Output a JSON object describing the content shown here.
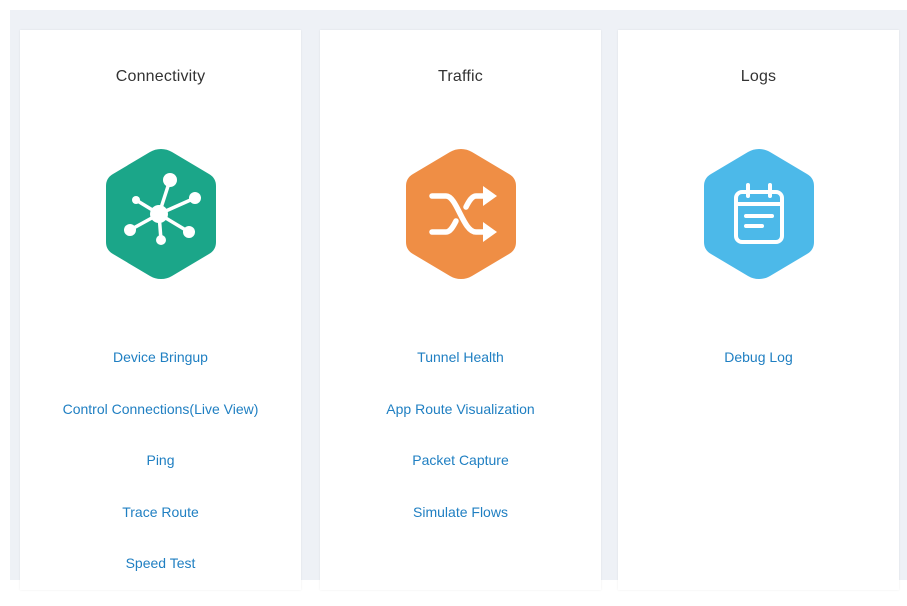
{
  "panels": [
    {
      "title": "Connectivity",
      "icon": "network-hub-icon",
      "color": "#1ba689",
      "links": [
        "Device Bringup",
        "Control Connections(Live View)",
        "Ping",
        "Trace Route",
        "Speed Test"
      ]
    },
    {
      "title": "Traffic",
      "icon": "shuffle-arrows-icon",
      "color": "#ef8e45",
      "links": [
        "Tunnel Health",
        "App Route Visualization",
        "Packet Capture",
        "Simulate Flows"
      ]
    },
    {
      "title": "Logs",
      "icon": "calendar-log-icon",
      "color": "#4cb9e9",
      "links": [
        "Debug Log"
      ]
    }
  ],
  "colors": {
    "background": "#eef1f6",
    "card": "#ffffff",
    "link": "#1f7fc2",
    "title": "#333333"
  }
}
